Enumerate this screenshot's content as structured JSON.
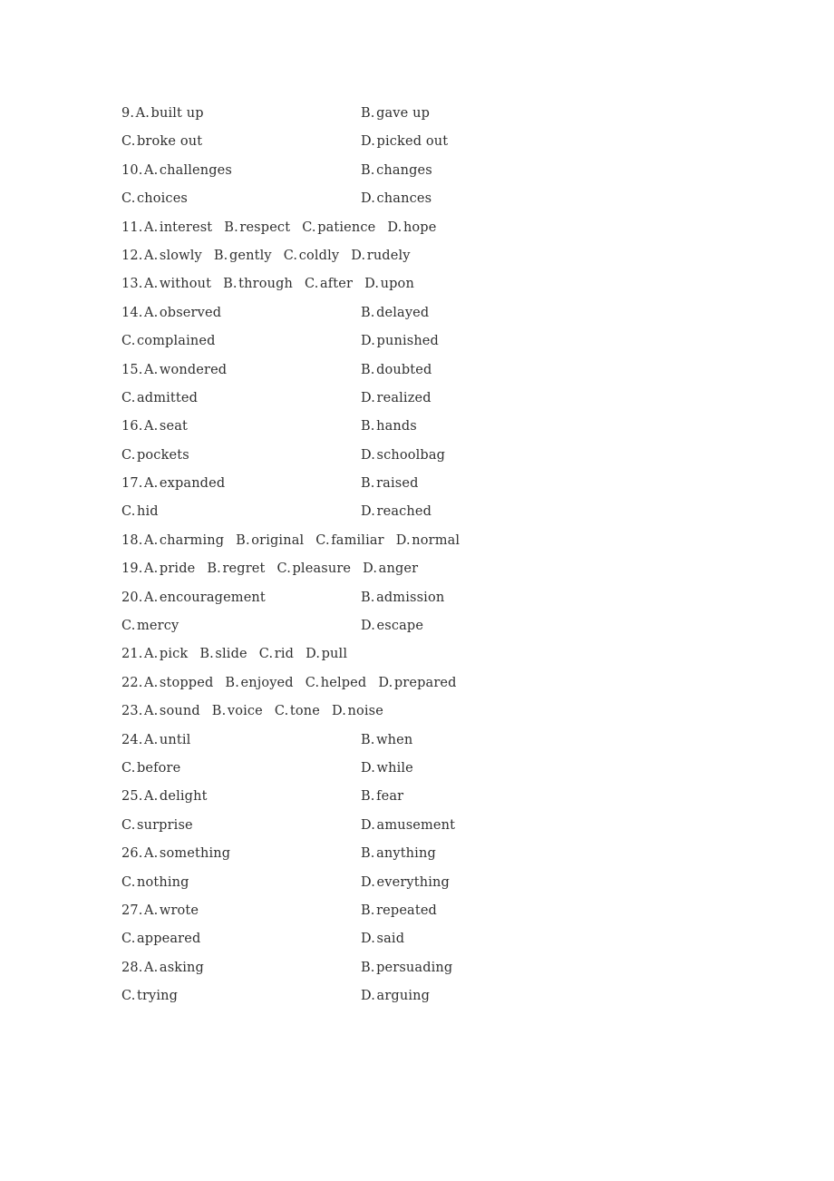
{
  "page": {
    "background_color": "#ffffff",
    "text_color": "#2f2f2f",
    "document_type": "cloze-test answer options"
  },
  "questions": [
    {
      "number": "9.",
      "layout": "two-column",
      "options": [
        {
          "letter": "A.",
          "text": "built up"
        },
        {
          "letter": "B.",
          "text": "gave up"
        },
        {
          "letter": "C.",
          "text": "broke out"
        },
        {
          "letter": "D.",
          "text": "picked out"
        }
      ]
    },
    {
      "number": "10.",
      "layout": "two-column",
      "options": [
        {
          "letter": "A.",
          "text": "challenges"
        },
        {
          "letter": "B.",
          "text": "changes"
        },
        {
          "letter": "C.",
          "text": "choices"
        },
        {
          "letter": "D.",
          "text": "chances"
        }
      ]
    },
    {
      "number": "11.",
      "layout": "inline",
      "options": [
        {
          "letter": "A.",
          "text": "interest"
        },
        {
          "letter": "B.",
          "text": "respect"
        },
        {
          "letter": "C.",
          "text": "patience"
        },
        {
          "letter": "D.",
          "text": "hope"
        }
      ]
    },
    {
      "number": "12.",
      "layout": "inline",
      "options": [
        {
          "letter": "A.",
          "text": "slowly"
        },
        {
          "letter": "B.",
          "text": "gently"
        },
        {
          "letter": "C.",
          "text": "coldly"
        },
        {
          "letter": "D.",
          "text": "rudely"
        }
      ]
    },
    {
      "number": "13.",
      "layout": "inline",
      "options": [
        {
          "letter": "A.",
          "text": "without"
        },
        {
          "letter": "B.",
          "text": "through"
        },
        {
          "letter": "C.",
          "text": "after"
        },
        {
          "letter": "D.",
          "text": "upon"
        }
      ]
    },
    {
      "number": "14.",
      "layout": "two-column",
      "options": [
        {
          "letter": "A.",
          "text": "observed"
        },
        {
          "letter": "B.",
          "text": "delayed"
        },
        {
          "letter": "C.",
          "text": "complained"
        },
        {
          "letter": "D.",
          "text": "punished"
        }
      ]
    },
    {
      "number": "15.",
      "layout": "two-column",
      "options": [
        {
          "letter": "A.",
          "text": "wondered"
        },
        {
          "letter": "B.",
          "text": "doubted"
        },
        {
          "letter": "C.",
          "text": "admitted"
        },
        {
          "letter": "D.",
          "text": "realized"
        }
      ]
    },
    {
      "number": "16.",
      "layout": "two-column",
      "options": [
        {
          "letter": "A.",
          "text": "seat"
        },
        {
          "letter": "B.",
          "text": "hands"
        },
        {
          "letter": "C.",
          "text": "pockets"
        },
        {
          "letter": "D.",
          "text": "schoolbag"
        }
      ]
    },
    {
      "number": "17.",
      "layout": "two-column",
      "options": [
        {
          "letter": "A.",
          "text": "expanded"
        },
        {
          "letter": "B.",
          "text": "raised"
        },
        {
          "letter": "C.",
          "text": "hid"
        },
        {
          "letter": "D.",
          "text": "reached"
        }
      ]
    },
    {
      "number": "18.",
      "layout": "inline",
      "options": [
        {
          "letter": "A.",
          "text": "charming"
        },
        {
          "letter": "B.",
          "text": "original"
        },
        {
          "letter": "C.",
          "text": "familiar"
        },
        {
          "letter": "D.",
          "text": "normal"
        }
      ]
    },
    {
      "number": "19.",
      "layout": "inline",
      "options": [
        {
          "letter": "A.",
          "text": "pride"
        },
        {
          "letter": "B.",
          "text": "regret"
        },
        {
          "letter": "C.",
          "text": "pleasure"
        },
        {
          "letter": "D.",
          "text": "anger"
        }
      ]
    },
    {
      "number": "20.",
      "layout": "two-column",
      "options": [
        {
          "letter": "A.",
          "text": "encouragement"
        },
        {
          "letter": "B.",
          "text": "admission"
        },
        {
          "letter": "C.",
          "text": "mercy"
        },
        {
          "letter": "D.",
          "text": "escape"
        }
      ]
    },
    {
      "number": "21.",
      "layout": "inline",
      "options": [
        {
          "letter": "A.",
          "text": "pick"
        },
        {
          "letter": "B.",
          "text": "slide"
        },
        {
          "letter": "C.",
          "text": "rid"
        },
        {
          "letter": "D.",
          "text": "pull"
        }
      ]
    },
    {
      "number": "22.",
      "layout": "inline",
      "options": [
        {
          "letter": "A.",
          "text": "stopped"
        },
        {
          "letter": "B.",
          "text": "enjoyed"
        },
        {
          "letter": "C.",
          "text": "helped"
        },
        {
          "letter": "D.",
          "text": "prepared"
        }
      ]
    },
    {
      "number": "23.",
      "layout": "inline",
      "options": [
        {
          "letter": "A.",
          "text": "sound"
        },
        {
          "letter": "B.",
          "text": "voice"
        },
        {
          "letter": "C.",
          "text": "tone"
        },
        {
          "letter": "D.",
          "text": "noise"
        }
      ]
    },
    {
      "number": "24.",
      "layout": "two-column",
      "options": [
        {
          "letter": "A.",
          "text": "until"
        },
        {
          "letter": "B.",
          "text": "when"
        },
        {
          "letter": "C.",
          "text": "before"
        },
        {
          "letter": "D.",
          "text": "while"
        }
      ]
    },
    {
      "number": "25.",
      "layout": "two-column",
      "options": [
        {
          "letter": "A.",
          "text": "delight"
        },
        {
          "letter": "B.",
          "text": "fear"
        },
        {
          "letter": "C.",
          "text": "surprise"
        },
        {
          "letter": "D.",
          "text": "amusement"
        }
      ]
    },
    {
      "number": "26.",
      "layout": "two-column",
      "options": [
        {
          "letter": "A.",
          "text": "something"
        },
        {
          "letter": "B.",
          "text": "anything"
        },
        {
          "letter": "C.",
          "text": "nothing"
        },
        {
          "letter": "D.",
          "text": "everything"
        }
      ]
    },
    {
      "number": "27.",
      "layout": "two-column",
      "options": [
        {
          "letter": "A.",
          "text": "wrote"
        },
        {
          "letter": "B.",
          "text": "repeated"
        },
        {
          "letter": "C.",
          "text": "appeared"
        },
        {
          "letter": "D.",
          "text": "said"
        }
      ]
    },
    {
      "number": "28.",
      "layout": "two-column",
      "options": [
        {
          "letter": "A.",
          "text": "asking"
        },
        {
          "letter": "B.",
          "text": "persuading"
        },
        {
          "letter": "C.",
          "text": "trying"
        },
        {
          "letter": "D.",
          "text": "arguing"
        }
      ]
    }
  ]
}
